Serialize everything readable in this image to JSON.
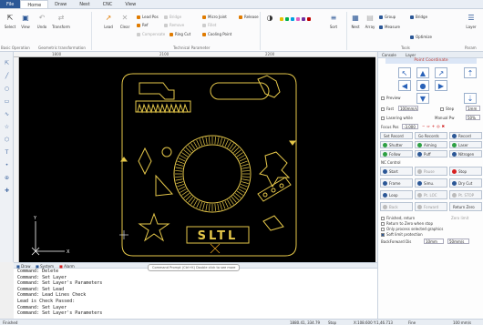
{
  "menu": {
    "file": "File",
    "tabs": [
      "Home",
      "Draw",
      "Nest",
      "CNC",
      "View"
    ]
  },
  "ribbon": {
    "select": "Select",
    "view": "View",
    "undo": "Undo",
    "transform": "Transform",
    "lead": "Lead",
    "clear": "Clear",
    "lead_pos": "Lead Pos",
    "ref": "Ref",
    "micro_joint": "Micro Joint",
    "release": "Release",
    "fillet": "Fillet",
    "bridge_col": "Bridge",
    "remove": "Remove",
    "compensate": "Compensate",
    "ring_cut": "Ring Cut",
    "cooling_point": "Cooling Point",
    "sort": "Sort",
    "nest": "Nest",
    "array": "Array",
    "group": "Group",
    "measure": "Measure",
    "optimize": "Optimize",
    "bridge": "Bridge",
    "layer": "Layer",
    "group_basic": "Basic Operation",
    "group_geo": "Geometric transformation",
    "group_tech": "Technical Parameter",
    "group_tools": "Tools",
    "group_params": "Param"
  },
  "ruler": {
    "top": [
      "1800",
      "2100",
      "2200"
    ]
  },
  "canvas": {
    "logo_text": "SLTL"
  },
  "panel": {
    "tabs": [
      "Console",
      "Layer"
    ],
    "header": "Point Coordinate",
    "preview": "Preview",
    "fast": "Fast",
    "fast_value": "100mm/s",
    "step": "Step",
    "step_value": "1mm",
    "lasering_while": "Lasering while",
    "manual_pw": "Manual Pw",
    "manual_pw_value": "50%",
    "focus_pos": "Focus Pos",
    "focus_value": "-3.000",
    "set_record": "Set Record",
    "go_records": "Go Records",
    "record": "Record",
    "shutter": "Shutter",
    "aiming": "Aiming",
    "laser": "Laser",
    "follow": "Follow",
    "puff": "Puff",
    "nitrogen": "Nitrogen",
    "nc_control": "NC Control",
    "start": "Start",
    "pause": "Pause",
    "stop": "Stop",
    "frame": "Frame",
    "simu": "Simu.",
    "dry_cut": "Dry Cut",
    "loop": "Loop",
    "pt_loc": "Pt. LOC",
    "pt_stop": "Pt. STOP",
    "back": "Back",
    "forward": "Forward",
    "return_zero": "Return Zero",
    "finished_return": "Finished, return",
    "zero_limit": "Zero limit",
    "return_zero_stop": "Return to Zero when stop",
    "only_selected": "Only process selected graphics",
    "soft_limit": "Soft limit protection",
    "back_forward_dis": "BackForward Dis",
    "bf_value1": "10mm",
    "bf_value2": "50mm/s"
  },
  "bottom": {
    "tabs": [
      "Draw",
      "System",
      "Alarm"
    ],
    "hint": "Command Prompt (Ctrl+K) Double click to see more",
    "commands": [
      "Command: Delete",
      "Command: Set Layer",
      "Command: Set Layer's Parameters",
      "Command: Set Lead",
      "Command: Lead Lines Check",
      "Lead is Check Passed:",
      "Command: Set Layer",
      "Command: Set Layer's Parameters"
    ]
  },
  "status": {
    "ready": "Finished",
    "coords": "1880.41, 334.79",
    "stop": "Stop",
    "machine": "X:108.600 Y:1,46.713",
    "fine": "Fine",
    "speed": "100 mm/s"
  }
}
